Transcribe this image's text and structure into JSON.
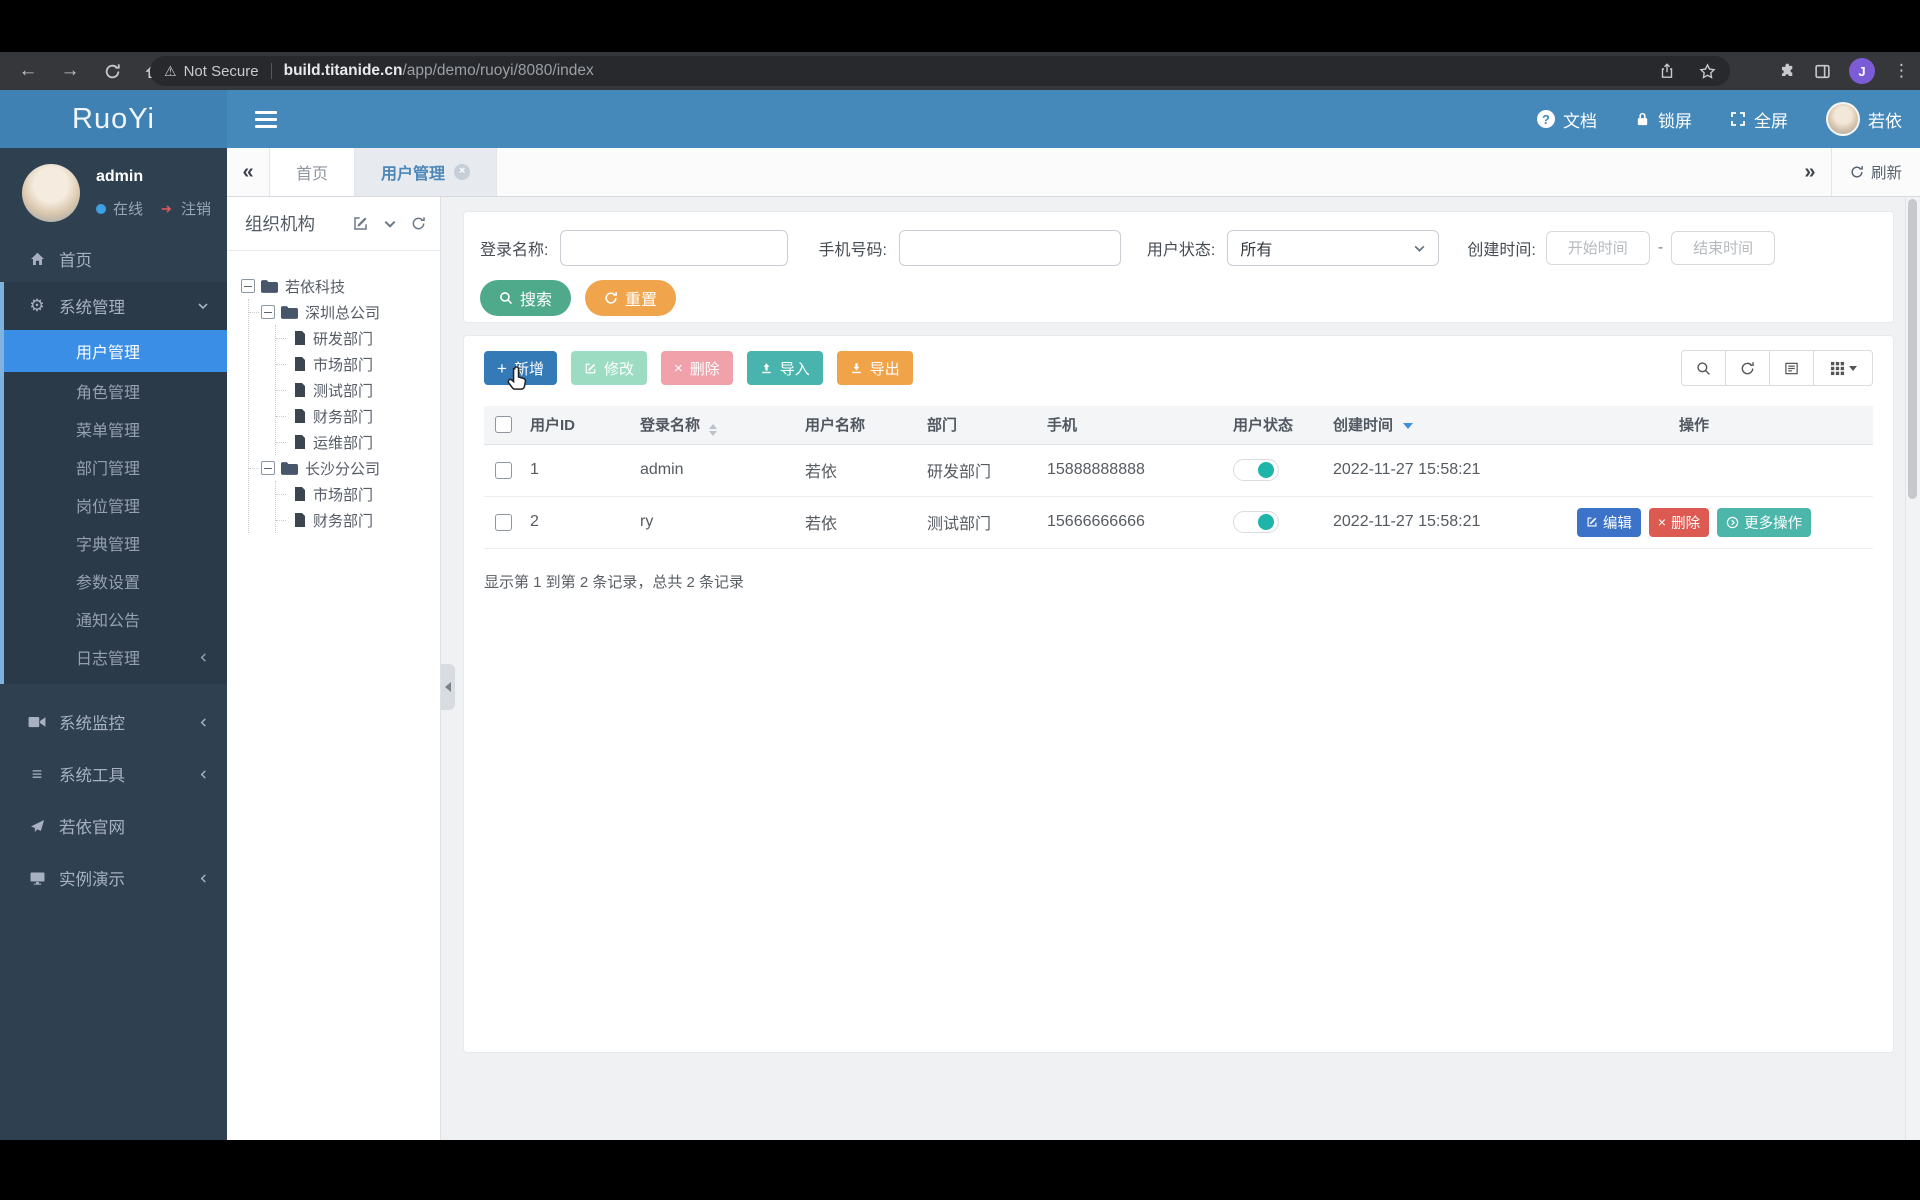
{
  "browser": {
    "security": "Not Secure",
    "url_host": "build.titanide.cn",
    "url_path": "/app/demo/ruoyi/8080/index",
    "profile_initial": "J"
  },
  "header": {
    "logo": "RuoYi",
    "docs": "文档",
    "lock_screen": "锁屏",
    "fullscreen": "全屏",
    "username": "若依"
  },
  "sidebar": {
    "username": "admin",
    "status_online": "在线",
    "logout": "注销",
    "home": "首页",
    "system_mgmt": "系统管理",
    "submenu": [
      "用户管理",
      "角色管理",
      "菜单管理",
      "部门管理",
      "岗位管理",
      "字典管理",
      "参数设置",
      "通知公告",
      "日志管理"
    ],
    "monitor": "系统监控",
    "tools": "系统工具",
    "official_site": "若依官网",
    "demo": "实例演示"
  },
  "tabs": {
    "home": "首页",
    "user_mgmt": "用户管理",
    "refresh": "刷新"
  },
  "tree": {
    "title": "组织机构",
    "nodes": [
      "若依科技",
      "深圳总公司",
      "研发部门",
      "市场部门",
      "测试部门",
      "财务部门",
      "运维部门",
      "长沙分公司",
      "市场部门",
      "财务部门"
    ]
  },
  "search": {
    "login_label": "登录名称:",
    "phone_label": "手机号码:",
    "status_label": "用户状态:",
    "status_value": "所有",
    "created_label": "创建时间:",
    "start_placeholder": "开始时间",
    "range_separator": "-",
    "end_placeholder": "结束时间",
    "search_button": "搜索",
    "reset_button": "重置"
  },
  "toolbar": {
    "add": "新增",
    "edit": "修改",
    "delete": "删除",
    "import": "导入",
    "export": "导出"
  },
  "table": {
    "columns": [
      "用户ID",
      "登录名称",
      "用户名称",
      "部门",
      "手机",
      "用户状态",
      "创建时间",
      "操作"
    ],
    "rows": [
      {
        "id": "1",
        "login": "admin",
        "name": "若依",
        "dept": "研发部门",
        "phone": "15888888888",
        "created": "2022-11-27 15:58:21"
      },
      {
        "id": "2",
        "login": "ry",
        "name": "若依",
        "dept": "测试部门",
        "phone": "15666666666",
        "created": "2022-11-27 15:58:21"
      }
    ],
    "row_actions": {
      "edit": "编辑",
      "delete": "删除",
      "more": "更多操作"
    }
  },
  "summary": "显示第 1 到第 2 条记录，总共 2 条记录",
  "colors": {
    "header_blue": "#4588ba",
    "sidebar_dark": "#2f4050",
    "active_item_blue": "#3a8ee6",
    "success_green": "#4fa98b",
    "warning_orange": "#f0a44b",
    "primary_blue": "#337ab7",
    "info_teal": "#49b3ad",
    "danger_red": "#d9534f",
    "toggle_teal": "#1db4a9"
  }
}
